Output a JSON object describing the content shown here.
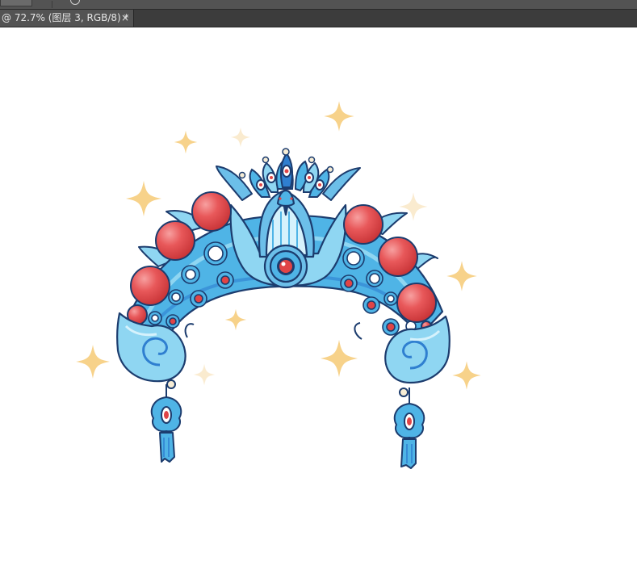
{
  "document_tab": {
    "title": "@ 72.7% (图层 3, RGB/8) *",
    "close_label": "×"
  },
  "artwork": {
    "subject": "Chinese opera phoenix crown illustration",
    "colors": {
      "outline": "#1c3c6e",
      "light_blue": "#8fd6f2",
      "mid_blue": "#4fb4e6",
      "deep_blue": "#2f7fd0",
      "pale_blue": "#d6f2fc",
      "red": "#e04446",
      "red_highlight": "#f58a8a",
      "gold_sparkle": "#f8d48a",
      "white": "#ffffff"
    }
  }
}
